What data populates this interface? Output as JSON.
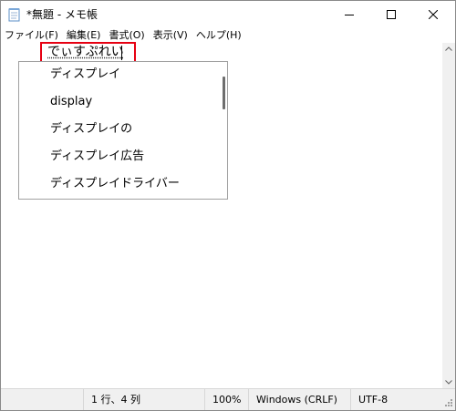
{
  "window": {
    "title": "*無題 - メモ帳",
    "app_icon": "notepad-icon"
  },
  "window_controls": {
    "minimize_icon": "minimize-icon",
    "maximize_icon": "maximize-icon",
    "close_icon": "close-icon"
  },
  "menu": {
    "items": [
      "ファイル(F)",
      "編集(E)",
      "書式(O)",
      "表示(V)",
      "ヘルプ(H)"
    ]
  },
  "editor": {
    "composition_text": "でぃすぷれい"
  },
  "suggestions": {
    "items": [
      "ディスプレイ",
      "display",
      "ディスプレイの",
      "ディスプレイ広告",
      "ディスプレイドライバー"
    ]
  },
  "statusbar": {
    "position": "1 行、4 列",
    "zoom": "100%",
    "line_ending": "Windows (CRLF)",
    "encoding": "UTF-8"
  },
  "colors": {
    "highlight": "#e60012",
    "chrome": "#f0f0f0"
  }
}
